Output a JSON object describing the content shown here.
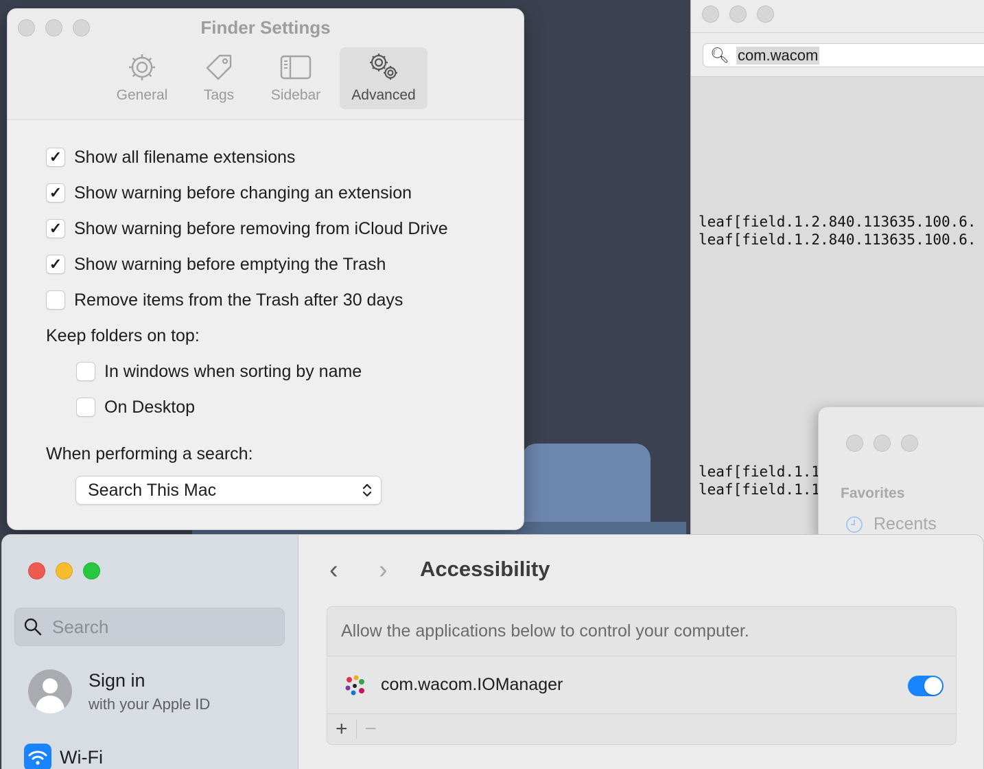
{
  "finder_settings": {
    "title": "Finder Settings",
    "tabs": [
      {
        "label": "General",
        "icon": "gear-icon"
      },
      {
        "label": "Tags",
        "icon": "tag-icon"
      },
      {
        "label": "Sidebar",
        "icon": "sidebar-icon"
      },
      {
        "label": "Advanced",
        "icon": "gears-icon",
        "active": true
      }
    ],
    "options": [
      {
        "label": "Show all filename extensions",
        "checked": true
      },
      {
        "label": "Show warning before changing an extension",
        "checked": true
      },
      {
        "label": "Show warning before removing from iCloud Drive",
        "checked": true
      },
      {
        "label": "Show warning before emptying the Trash",
        "checked": true
      },
      {
        "label": "Remove items from the Trash after 30 days",
        "checked": false
      }
    ],
    "keep_folders_label": "Keep folders on top:",
    "keep_folders": [
      {
        "label": "In windows when sorting by name",
        "checked": false
      },
      {
        "label": "On Desktop",
        "checked": false
      }
    ],
    "search_label": "When performing a search:",
    "search_value": "Search This Mac"
  },
  "terminal": {
    "search_value": "com.wacom",
    "lines_top": [
      "leaf[field.1.2.840.113635.100.6.",
      "leaf[field.1.2.840.113635.100.6."
    ],
    "lines_bottom": [
      "leaf[field.1.1",
      "leaf[field.1.1"
    ]
  },
  "mini_finder": {
    "section": "Favorites",
    "item": "Recents"
  },
  "system_settings": {
    "search_placeholder": "Search",
    "signin_title": "Sign in",
    "signin_subtitle": "with your Apple ID",
    "wifi_label": "Wi-Fi",
    "page_title": "Accessibility",
    "description": "Allow the applications below to control your computer.",
    "apps": [
      {
        "name": "com.wacom.IOManager",
        "enabled": true
      }
    ],
    "add_label": "+",
    "remove_label": "−"
  },
  "colors": {
    "accent": "#1a84ff",
    "close": "#ee5a51",
    "minimize": "#f5bd2d",
    "zoom": "#27c841"
  }
}
